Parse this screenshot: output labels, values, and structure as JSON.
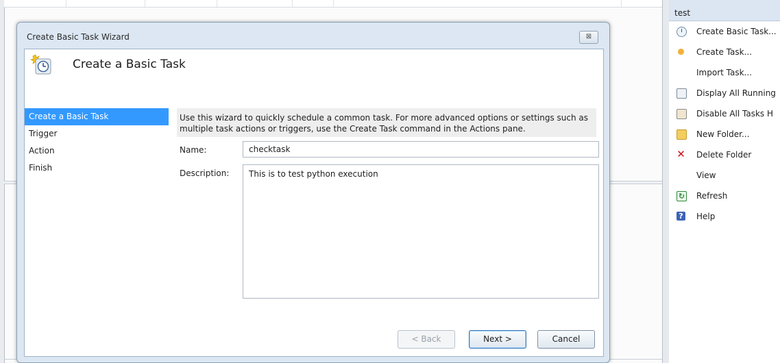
{
  "actions_pane": {
    "header": "test",
    "items": [
      {
        "label": "Create Basic Task...",
        "icon": "clock-task-icon"
      },
      {
        "label": "Create Task...",
        "icon": "task-icon"
      },
      {
        "label": "Import Task...",
        "icon": ""
      },
      {
        "label": "Display All Running",
        "icon": "running-tasks-icon"
      },
      {
        "label": "Disable All Tasks H",
        "icon": "disable-history-icon"
      },
      {
        "label": "New Folder...",
        "icon": "folder-icon"
      },
      {
        "label": "Delete Folder",
        "icon": "delete-icon"
      },
      {
        "label": "View",
        "icon": ""
      },
      {
        "label": "Refresh",
        "icon": "refresh-icon"
      },
      {
        "label": "Help",
        "icon": "help-icon"
      }
    ]
  },
  "dialog": {
    "title": "Create Basic Task Wizard",
    "close_symbol": "⊠",
    "heading": "Create a Basic Task",
    "steps": [
      "Create a Basic Task",
      "Trigger",
      "Action",
      "Finish"
    ],
    "intro": "Use this wizard to quickly schedule a common task.  For more advanced options or settings such as multiple task actions or triggers, use the Create Task command in the Actions pane.",
    "name_label": "Name:",
    "name_value": "checktask",
    "description_label": "Description:",
    "description_value": "This is to test python execution",
    "buttons": {
      "back": "< Back",
      "next": "Next >",
      "cancel": "Cancel"
    }
  },
  "colors": {
    "selection": "#3399ff",
    "dialog_frame": "#dce7f3",
    "actions_header": "#dbe6f2"
  }
}
